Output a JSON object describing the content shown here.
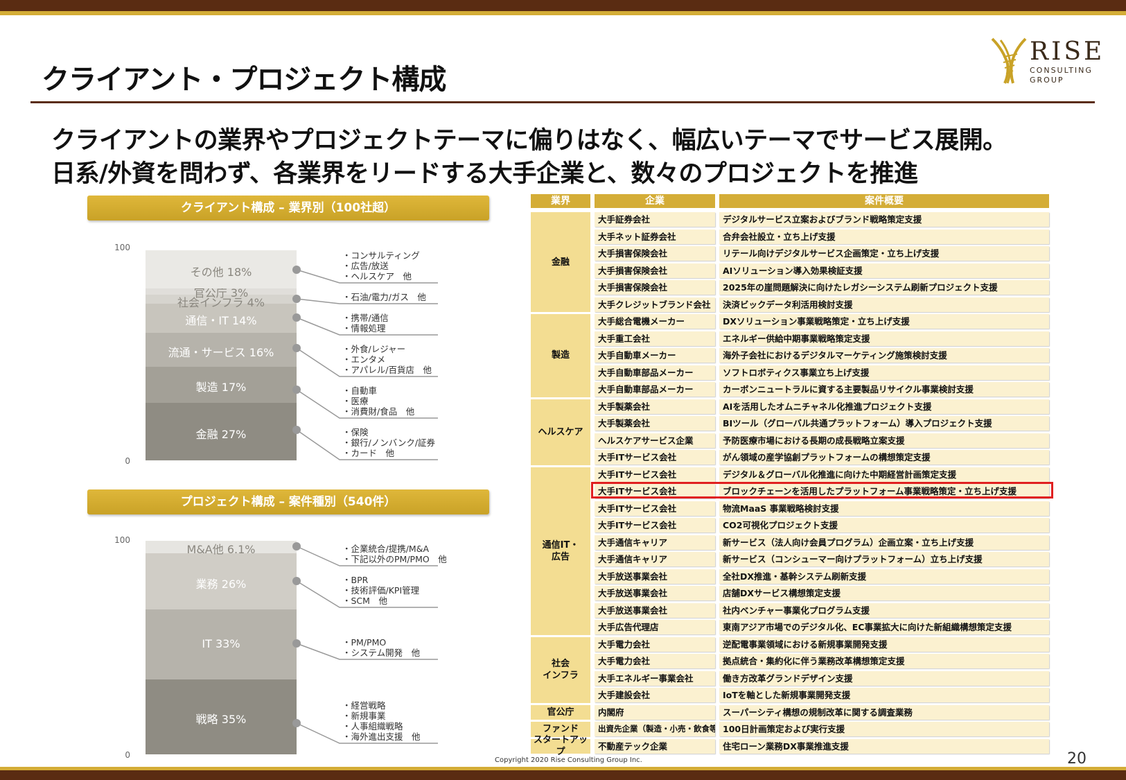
{
  "title": "クライアント・プロジェクト構成",
  "subtitle_lines": [
    "クライアントの業界やプロジェクトテーマに偏りはなく、幅広いテーマでサービス展開。",
    "日系/外資を問わず、各業界をリードする大手企業と、数々のプロジェクトを推進"
  ],
  "logo": {
    "name": "RISE",
    "line1": "CONSULTING",
    "line2": "GROUP"
  },
  "colors": {
    "brown": "#5a2c12",
    "gold": "#d4ad37",
    "highlight": "#e02020"
  },
  "chart_data": [
    {
      "type": "bar",
      "stacked": true,
      "title": "クライアント構成 – 業界別（100社超）",
      "ylim": [
        0,
        100
      ],
      "yticks": [
        "100",
        "0"
      ],
      "segments": [
        {
          "label": "金融 27%",
          "value": 27,
          "color": "#8f8c83",
          "notes": [
            "・保険",
            "・銀行/ノンバンク/証券",
            "・カード　他"
          ]
        },
        {
          "label": "製造 17%",
          "value": 17,
          "color": "#a3a097",
          "notes": [
            "・自動車",
            "・医療",
            "・消費財/食品　他"
          ]
        },
        {
          "label": "流通・サービス 16%",
          "value": 16,
          "color": "#b6b3ab",
          "notes": [
            "・外食/レジャー",
            "・エンタメ",
            "・アパレル/百貨店　他"
          ]
        },
        {
          "label": "通信・IT 14%",
          "value": 14,
          "color": "#c8c5bd",
          "notes": [
            "・携帯/通信",
            "・情報処理"
          ]
        },
        {
          "label": "社会インフラ 4%",
          "value": 4,
          "color": "#d6d4ce",
          "notes": [
            "・石油/電力/ガス　他"
          ]
        },
        {
          "label": "官公庁 3%",
          "value": 3,
          "color": "#e0deda",
          "notes": []
        },
        {
          "label": "その他 18%",
          "value": 18,
          "color": "#eae9e5",
          "notes": [
            "・コンサルティング",
            "・広告/放送",
            "・ヘルスケア　他"
          ]
        }
      ]
    },
    {
      "type": "bar",
      "stacked": true,
      "title": "プロジェクト構成 – 案件種別（540件）",
      "ylim": [
        0,
        100
      ],
      "yticks": [
        "100",
        "0"
      ],
      "segments": [
        {
          "label": "戦略 35%",
          "value": 35,
          "color": "#8f8c83",
          "notes": [
            "・経営戦略",
            "・新規事業",
            "・人事組織戦略",
            "・海外進出支援　他"
          ]
        },
        {
          "label": "IT 33%",
          "value": 33,
          "color": "#b6b3ab",
          "notes": [
            "・PM/PMO",
            "・システム開発　他"
          ]
        },
        {
          "label": "業務 26%",
          "value": 26,
          "color": "#d0cdc6",
          "notes": [
            "・BPR",
            "・技術評価/KPI管理",
            "・SCM　他"
          ]
        },
        {
          "label": "M&A他 6.1%",
          "value": 6.1,
          "color": "#e6e5e1",
          "notes": [
            "・企業統合/提携/M&A",
            "・下記以外のPM/PMO　他"
          ]
        }
      ]
    }
  ],
  "table": {
    "headers": [
      "業界",
      "企業",
      "案件概要"
    ],
    "groups": [
      {
        "industry": "金融",
        "rows": [
          [
            "大手証券会社",
            "デジタルサービス立案およびブランド戦略策定支援"
          ],
          [
            "大手ネット証券会社",
            "合弁会社設立・立ち上げ支援"
          ],
          [
            "大手損害保険会社",
            "リテール向けデジタルサービス企画策定・立ち上げ支援"
          ],
          [
            "大手損害保険会社",
            "AIソリューション導入効果検証支援"
          ],
          [
            "大手損害保険会社",
            "2025年の崖問題解決に向けたレガシーシステム刷新プロジェクト支援"
          ],
          [
            "大手クレジットブランド会社",
            "決済ビックデータ利活用検討支援"
          ]
        ]
      },
      {
        "industry": "製造",
        "rows": [
          [
            "大手総合電機メーカー",
            "DXソリューション事業戦略策定・立ち上げ支援"
          ],
          [
            "大手重工会社",
            "エネルギー供給中期事業戦略策定支援"
          ],
          [
            "大手自動車メーカー",
            "海外子会社におけるデジタルマーケティング施策検討支援"
          ],
          [
            "大手自動車部品メーカー",
            "ソフトロボティクス事業立ち上げ支援"
          ],
          [
            "大手自動車部品メーカー",
            "カーボンニュートラルに資する主要製品リサイクル事業検討支援"
          ]
        ]
      },
      {
        "industry": "ヘルスケア",
        "rows": [
          [
            "大手製薬会社",
            "AIを活用したオムニチャネル化推進プロジェクト支援"
          ],
          [
            "大手製薬会社",
            "BIツール（グローバル共通プラットフォーム）導入プロジェクト支援"
          ],
          [
            "ヘルスケアサービス企業",
            "予防医療市場における長期の成長戦略立案支援"
          ],
          [
            "大手ITサービス会社",
            "がん領域の産学協創プラットフォームの構想策定支援"
          ]
        ]
      },
      {
        "industry": "通信IT・\n広告",
        "rows": [
          [
            "大手ITサービス会社",
            "デジタル＆グローバル化推進に向けた中期経営計画策定支援"
          ],
          [
            "大手ITサービス会社",
            "ブロックチェーンを活用したプラットフォーム事業戦略策定・立ち上げ支援"
          ],
          [
            "大手ITサービス会社",
            "物流MaaS 事業戦略検討支援"
          ],
          [
            "大手ITサービス会社",
            "CO2可視化プロジェクト支援"
          ],
          [
            "大手通信キャリア",
            "新サービス（法人向け会員プログラム）企画立案・立ち上げ支援"
          ],
          [
            "大手通信キャリア",
            "新サービス（コンシューマー向けプラットフォーム）立ち上げ支援"
          ],
          [
            "大手放送事業会社",
            "全社DX推進・基幹システム刷新支援"
          ],
          [
            "大手放送事業会社",
            "店舗DXサービス構想策定支援"
          ],
          [
            "大手放送事業会社",
            "社内ベンチャー事業化プログラム支援"
          ],
          [
            "大手広告代理店",
            "東南アジア市場でのデジタル化、EC事業拡大に向けた新組織構想策定支援"
          ]
        ]
      },
      {
        "industry": "社会\nインフラ",
        "rows": [
          [
            "大手電力会社",
            "逆配電事業領域における新規事業開発支援"
          ],
          [
            "大手電力会社",
            "拠点統合・集約化に伴う業務改革構想策定支援"
          ],
          [
            "大手エネルギー事業会社",
            "働き方改革グランドデザイン支援"
          ],
          [
            "大手建設会社",
            "IoTを軸とした新規事業開発支援"
          ]
        ]
      },
      {
        "industry": "官公庁",
        "rows": [
          [
            "内閣府",
            "スーパーシティ構想の規制改革に関する調査業務"
          ]
        ]
      },
      {
        "industry": "ファンド",
        "rows": [
          [
            "出資先企業（製造・小売・飲食等）",
            "100日計画策定および実行支援"
          ]
        ]
      },
      {
        "industry": "スタートアップ",
        "rows": [
          [
            "不動産テック企業",
            "住宅ローン業務DX事業推進支援"
          ]
        ]
      }
    ]
  },
  "copyright": "Copyright 2020 Rise Consulting Group Inc.",
  "page_number": "20"
}
